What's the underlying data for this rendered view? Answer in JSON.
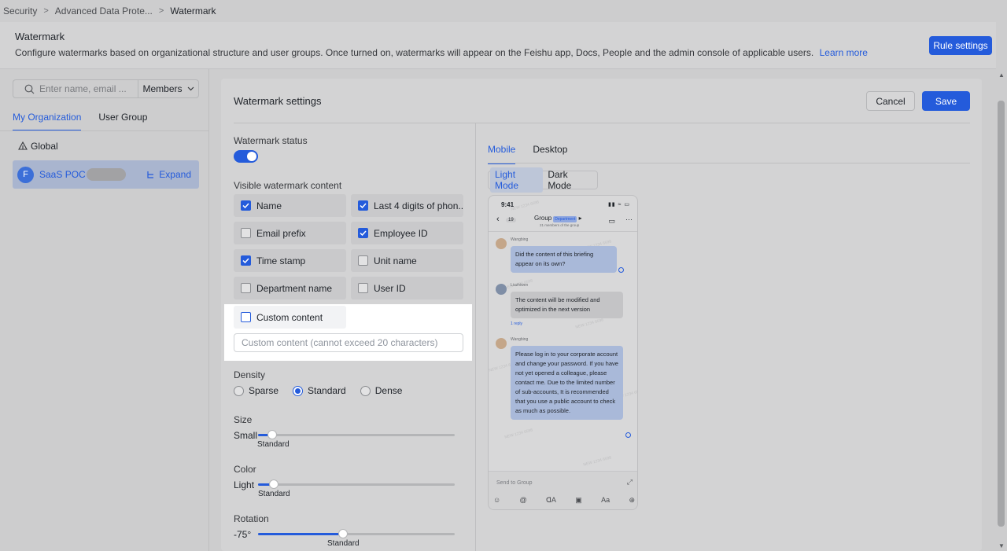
{
  "breadcrumb": [
    "Security",
    "Advanced Data Prote...",
    "Watermark"
  ],
  "header": {
    "title": "Watermark",
    "desc": "Configure watermarks based on organizational structure and user groups. Once turned on, watermarks will appear on the Feishu app, Docs, People and the admin console of applicable users.",
    "learn_more": "Learn more",
    "rule_settings": "Rule settings"
  },
  "sidebar": {
    "search_placeholder": "Enter name, email ...",
    "members": "Members",
    "tabs": [
      "My Organization",
      "User Group"
    ],
    "global": "Global",
    "org": {
      "initial": "F",
      "name": "SaaS POC",
      "expand": "Expand"
    }
  },
  "settings": {
    "title": "Watermark settings",
    "cancel": "Cancel",
    "save": "Save",
    "status_label": "Watermark status",
    "status_on": true,
    "content_label": "Visible watermark content",
    "items": [
      {
        "label": "Name",
        "checked": true
      },
      {
        "label": "Last 4 digits of phon...",
        "checked": true
      },
      {
        "label": "Email prefix",
        "checked": false
      },
      {
        "label": "Employee ID",
        "checked": true
      },
      {
        "label": "Time stamp",
        "checked": true
      },
      {
        "label": "Unit name",
        "checked": false
      },
      {
        "label": "Department name",
        "checked": false
      },
      {
        "label": "User ID",
        "checked": false
      },
      {
        "label": "Custom content",
        "checked": true
      }
    ],
    "custom_placeholder": "Custom content (cannot exceed 20 characters)",
    "density": {
      "label": "Density",
      "options": [
        "Sparse",
        "Standard",
        "Dense"
      ],
      "selected": "Standard"
    },
    "size": {
      "label": "Size",
      "min_label": "Small",
      "value_label": "Standard",
      "level": 0.07
    },
    "color": {
      "label": "Color",
      "min_label": "Light",
      "value_label": "Standard",
      "level": 0.08
    },
    "rotation": {
      "label": "Rotation",
      "min_label": "-75°",
      "value_label": "Standard",
      "level": 0.43
    }
  },
  "preview": {
    "tabs": [
      "Mobile",
      "Desktop"
    ],
    "modes": [
      "Light Mode",
      "Dark Mode"
    ],
    "phone": {
      "time": "9:41",
      "back_count": "19",
      "group": "Group",
      "dept_badge": "Department",
      "members": "21 members of the group",
      "messages": [
        {
          "sender": "Wangbing",
          "text": "Did the content of this briefing appear on its own?"
        },
        {
          "sender": "Liuzhiwen",
          "text": "The content will be modified and optimized in the next version",
          "reply": "1 reply"
        },
        {
          "sender": "Wangbing",
          "text": "Please log in to your corporate account and change your password. If you have not yet opened a colleague, please contact me. Due to the limited number of sub-accounts, It is recommended that you use a public account to check as much as possible."
        }
      ],
      "compose_placeholder": "Send to Group",
      "tools": [
        "☺",
        "@",
        "ꓷA",
        "▣",
        "Aa",
        "⊕"
      ]
    }
  },
  "colors": {
    "accent": "#245bdb",
    "highlight": "#ffffff"
  }
}
